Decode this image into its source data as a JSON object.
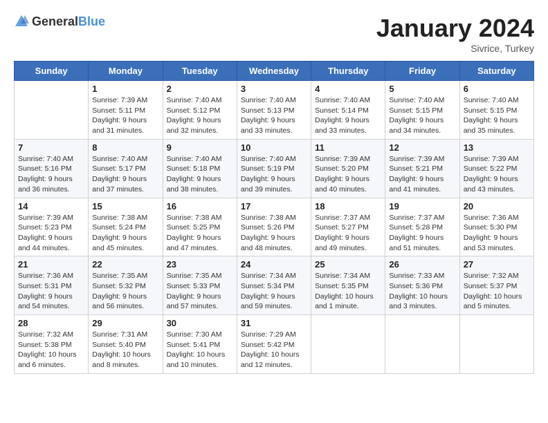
{
  "header": {
    "logo_general": "General",
    "logo_blue": "Blue",
    "month_title": "January 2024",
    "subtitle": "Sivrice, Turkey"
  },
  "days_of_week": [
    "Sunday",
    "Monday",
    "Tuesday",
    "Wednesday",
    "Thursday",
    "Friday",
    "Saturday"
  ],
  "weeks": [
    [
      {
        "day": "",
        "info": ""
      },
      {
        "day": "1",
        "info": "Sunrise: 7:39 AM\nSunset: 5:11 PM\nDaylight: 9 hours\nand 31 minutes."
      },
      {
        "day": "2",
        "info": "Sunrise: 7:40 AM\nSunset: 5:12 PM\nDaylight: 9 hours\nand 32 minutes."
      },
      {
        "day": "3",
        "info": "Sunrise: 7:40 AM\nSunset: 5:13 PM\nDaylight: 9 hours\nand 33 minutes."
      },
      {
        "day": "4",
        "info": "Sunrise: 7:40 AM\nSunset: 5:14 PM\nDaylight: 9 hours\nand 33 minutes."
      },
      {
        "day": "5",
        "info": "Sunrise: 7:40 AM\nSunset: 5:15 PM\nDaylight: 9 hours\nand 34 minutes."
      },
      {
        "day": "6",
        "info": "Sunrise: 7:40 AM\nSunset: 5:15 PM\nDaylight: 9 hours\nand 35 minutes."
      }
    ],
    [
      {
        "day": "7",
        "info": "Sunrise: 7:40 AM\nSunset: 5:16 PM\nDaylight: 9 hours\nand 36 minutes."
      },
      {
        "day": "8",
        "info": "Sunrise: 7:40 AM\nSunset: 5:17 PM\nDaylight: 9 hours\nand 37 minutes."
      },
      {
        "day": "9",
        "info": "Sunrise: 7:40 AM\nSunset: 5:18 PM\nDaylight: 9 hours\nand 38 minutes."
      },
      {
        "day": "10",
        "info": "Sunrise: 7:40 AM\nSunset: 5:19 PM\nDaylight: 9 hours\nand 39 minutes."
      },
      {
        "day": "11",
        "info": "Sunrise: 7:39 AM\nSunset: 5:20 PM\nDaylight: 9 hours\nand 40 minutes."
      },
      {
        "day": "12",
        "info": "Sunrise: 7:39 AM\nSunset: 5:21 PM\nDaylight: 9 hours\nand 41 minutes."
      },
      {
        "day": "13",
        "info": "Sunrise: 7:39 AM\nSunset: 5:22 PM\nDaylight: 9 hours\nand 43 minutes."
      }
    ],
    [
      {
        "day": "14",
        "info": "Sunrise: 7:39 AM\nSunset: 5:23 PM\nDaylight: 9 hours\nand 44 minutes."
      },
      {
        "day": "15",
        "info": "Sunrise: 7:38 AM\nSunset: 5:24 PM\nDaylight: 9 hours\nand 45 minutes."
      },
      {
        "day": "16",
        "info": "Sunrise: 7:38 AM\nSunset: 5:25 PM\nDaylight: 9 hours\nand 47 minutes."
      },
      {
        "day": "17",
        "info": "Sunrise: 7:38 AM\nSunset: 5:26 PM\nDaylight: 9 hours\nand 48 minutes."
      },
      {
        "day": "18",
        "info": "Sunrise: 7:37 AM\nSunset: 5:27 PM\nDaylight: 9 hours\nand 49 minutes."
      },
      {
        "day": "19",
        "info": "Sunrise: 7:37 AM\nSunset: 5:28 PM\nDaylight: 9 hours\nand 51 minutes."
      },
      {
        "day": "20",
        "info": "Sunrise: 7:36 AM\nSunset: 5:30 PM\nDaylight: 9 hours\nand 53 minutes."
      }
    ],
    [
      {
        "day": "21",
        "info": "Sunrise: 7:36 AM\nSunset: 5:31 PM\nDaylight: 9 hours\nand 54 minutes."
      },
      {
        "day": "22",
        "info": "Sunrise: 7:35 AM\nSunset: 5:32 PM\nDaylight: 9 hours\nand 56 minutes."
      },
      {
        "day": "23",
        "info": "Sunrise: 7:35 AM\nSunset: 5:33 PM\nDaylight: 9 hours\nand 57 minutes."
      },
      {
        "day": "24",
        "info": "Sunrise: 7:34 AM\nSunset: 5:34 PM\nDaylight: 9 hours\nand 59 minutes."
      },
      {
        "day": "25",
        "info": "Sunrise: 7:34 AM\nSunset: 5:35 PM\nDaylight: 10 hours\nand 1 minute."
      },
      {
        "day": "26",
        "info": "Sunrise: 7:33 AM\nSunset: 5:36 PM\nDaylight: 10 hours\nand 3 minutes."
      },
      {
        "day": "27",
        "info": "Sunrise: 7:32 AM\nSunset: 5:37 PM\nDaylight: 10 hours\nand 5 minutes."
      }
    ],
    [
      {
        "day": "28",
        "info": "Sunrise: 7:32 AM\nSunset: 5:38 PM\nDaylight: 10 hours\nand 6 minutes."
      },
      {
        "day": "29",
        "info": "Sunrise: 7:31 AM\nSunset: 5:40 PM\nDaylight: 10 hours\nand 8 minutes."
      },
      {
        "day": "30",
        "info": "Sunrise: 7:30 AM\nSunset: 5:41 PM\nDaylight: 10 hours\nand 10 minutes."
      },
      {
        "day": "31",
        "info": "Sunrise: 7:29 AM\nSunset: 5:42 PM\nDaylight: 10 hours\nand 12 minutes."
      },
      {
        "day": "",
        "info": ""
      },
      {
        "day": "",
        "info": ""
      },
      {
        "day": "",
        "info": ""
      }
    ]
  ]
}
